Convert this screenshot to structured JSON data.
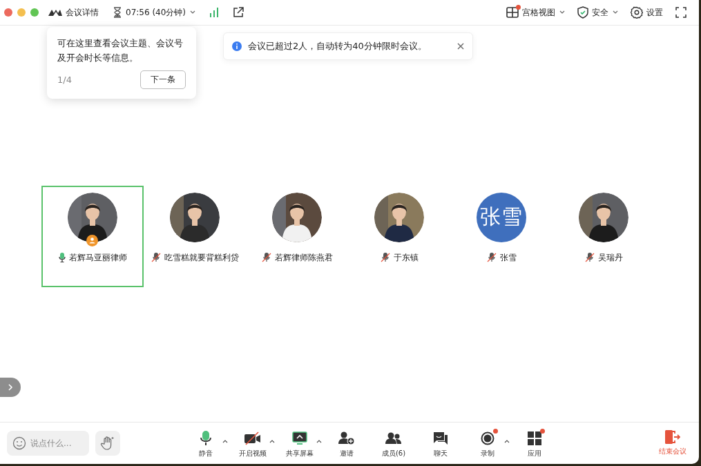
{
  "top_bar": {
    "meeting_details": "会议详情",
    "timer": "07:56 (40分钟)",
    "view": {
      "label": "宫格视图",
      "badge": true
    },
    "security": "安全",
    "settings": "设置"
  },
  "tooltip": {
    "text": "可在这里查看会议主题、会议号及开会时长等信息。",
    "step": "1/4",
    "next": "下一条"
  },
  "notice": {
    "text": "会议已超过2人，自动转为40分钟限时会议。"
  },
  "participants": [
    {
      "name": "若辉马亚丽律师",
      "kind": "picture",
      "muted": false,
      "active": true,
      "host": true
    },
    {
      "name": "吃雪糕就要背糕利贷",
      "kind": "picture",
      "muted": true,
      "active": false,
      "host": false
    },
    {
      "name": "若辉律师陈燕君",
      "kind": "picture",
      "muted": true,
      "active": false,
      "host": false
    },
    {
      "name": "于东镇",
      "kind": "picture",
      "muted": true,
      "active": false,
      "host": false
    },
    {
      "name": "张雪",
      "kind": "initials",
      "initials": "张雪",
      "muted": true,
      "active": false,
      "host": false
    },
    {
      "name": "吴瑞丹",
      "kind": "picture",
      "muted": true,
      "active": false,
      "host": false
    }
  ],
  "chat_input": {
    "placeholder": "说点什么..."
  },
  "toolbar": [
    {
      "kind": "mic",
      "label": "静音",
      "menu": true,
      "badge": false
    },
    {
      "kind": "video",
      "label": "开启视频",
      "menu": true,
      "badge": false
    },
    {
      "kind": "share",
      "label": "共享屏幕",
      "menu": true,
      "badge": false
    },
    {
      "kind": "invite",
      "label": "邀请",
      "menu": false,
      "badge": false
    },
    {
      "kind": "members",
      "label": "成员(6)",
      "menu": false,
      "badge": false
    },
    {
      "kind": "chat",
      "label": "聊天",
      "menu": false,
      "badge": false
    },
    {
      "kind": "record",
      "label": "录制",
      "menu": true,
      "badge": true
    },
    {
      "kind": "apps",
      "label": "应用",
      "menu": false,
      "badge": true
    }
  ],
  "end_button": "结束会议"
}
